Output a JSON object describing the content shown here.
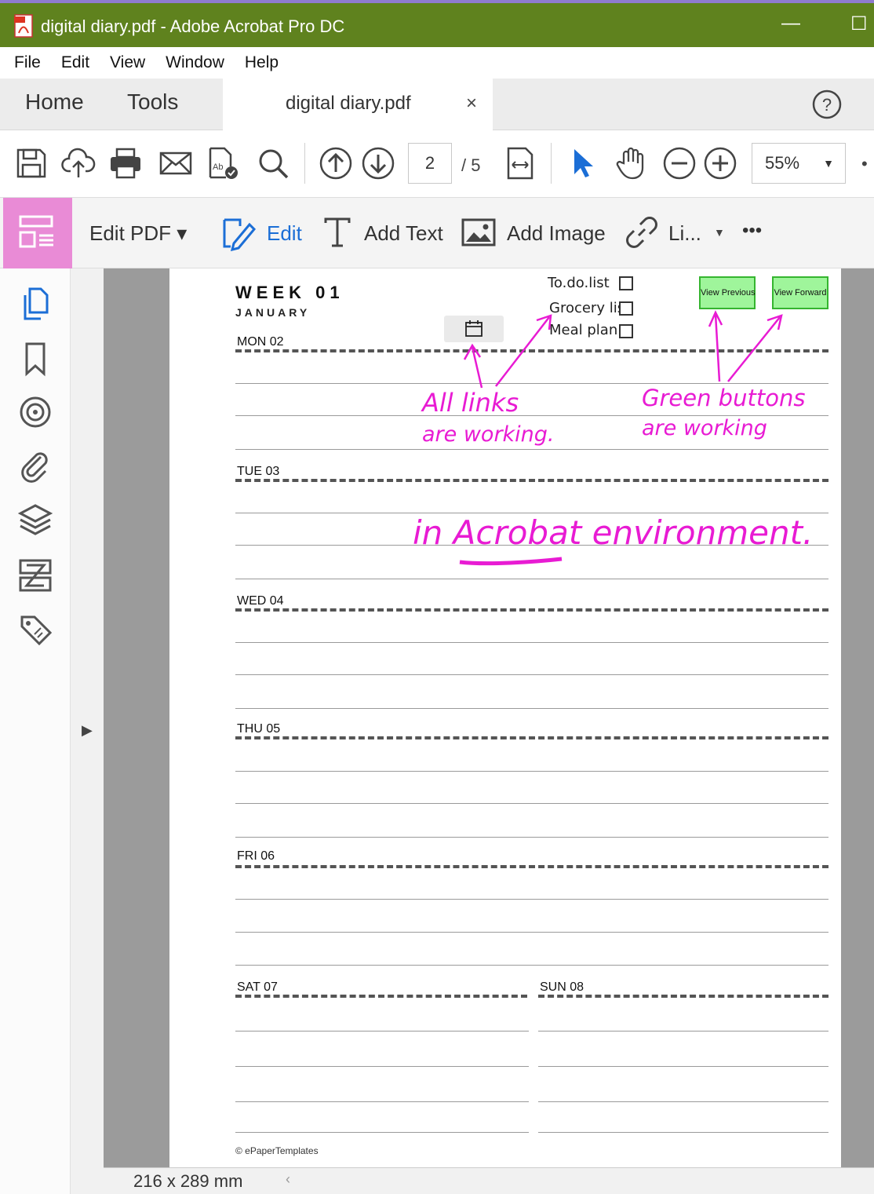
{
  "window": {
    "title": "digital diary.pdf - Adobe Acrobat Pro DC",
    "minimize": "—",
    "maximize": "☐"
  },
  "menu": [
    "File",
    "Edit",
    "View",
    "Window",
    "Help"
  ],
  "tabs": {
    "home": "Home",
    "tools": "Tools",
    "document": "digital diary.pdf",
    "close": "×"
  },
  "toolbar": {
    "page_current": "2",
    "page_total": "/ 5",
    "zoom": "55%"
  },
  "editbar": {
    "edit_pdf": "Edit PDF ▾",
    "edit": "Edit",
    "add_text": "Add Text",
    "add_image": "Add Image",
    "link": "Li...",
    "more": "•••"
  },
  "status": {
    "page_size": "216 x 289 mm",
    "scroll_left": "‹"
  },
  "page": {
    "week": "WEEK 01",
    "month": "JANUARY",
    "days": [
      "MON  02",
      "TUE  03",
      "WED  04",
      "THU  05",
      "FRI  06",
      "SAT  07",
      "SUN  08"
    ],
    "checklist": [
      "To.do.list",
      "Grocery list",
      "Meal plan"
    ],
    "view_previous": "View Previous",
    "view_forward": "View Forward",
    "footer": "© ePaperTemplates"
  },
  "annotations": {
    "links_line1": "All links",
    "links_line2": "are working.",
    "buttons_line1": "Green buttons",
    "buttons_line2": "are working",
    "environment": "in Acrobat environment."
  },
  "colors": {
    "titlebar": "#5f821e",
    "edit_accent": "#e98bd6",
    "annotation": "#e81bd3",
    "button_fill": "#9ff59b",
    "button_border": "#35b52f",
    "edit_blue": "#1b6ed6"
  }
}
